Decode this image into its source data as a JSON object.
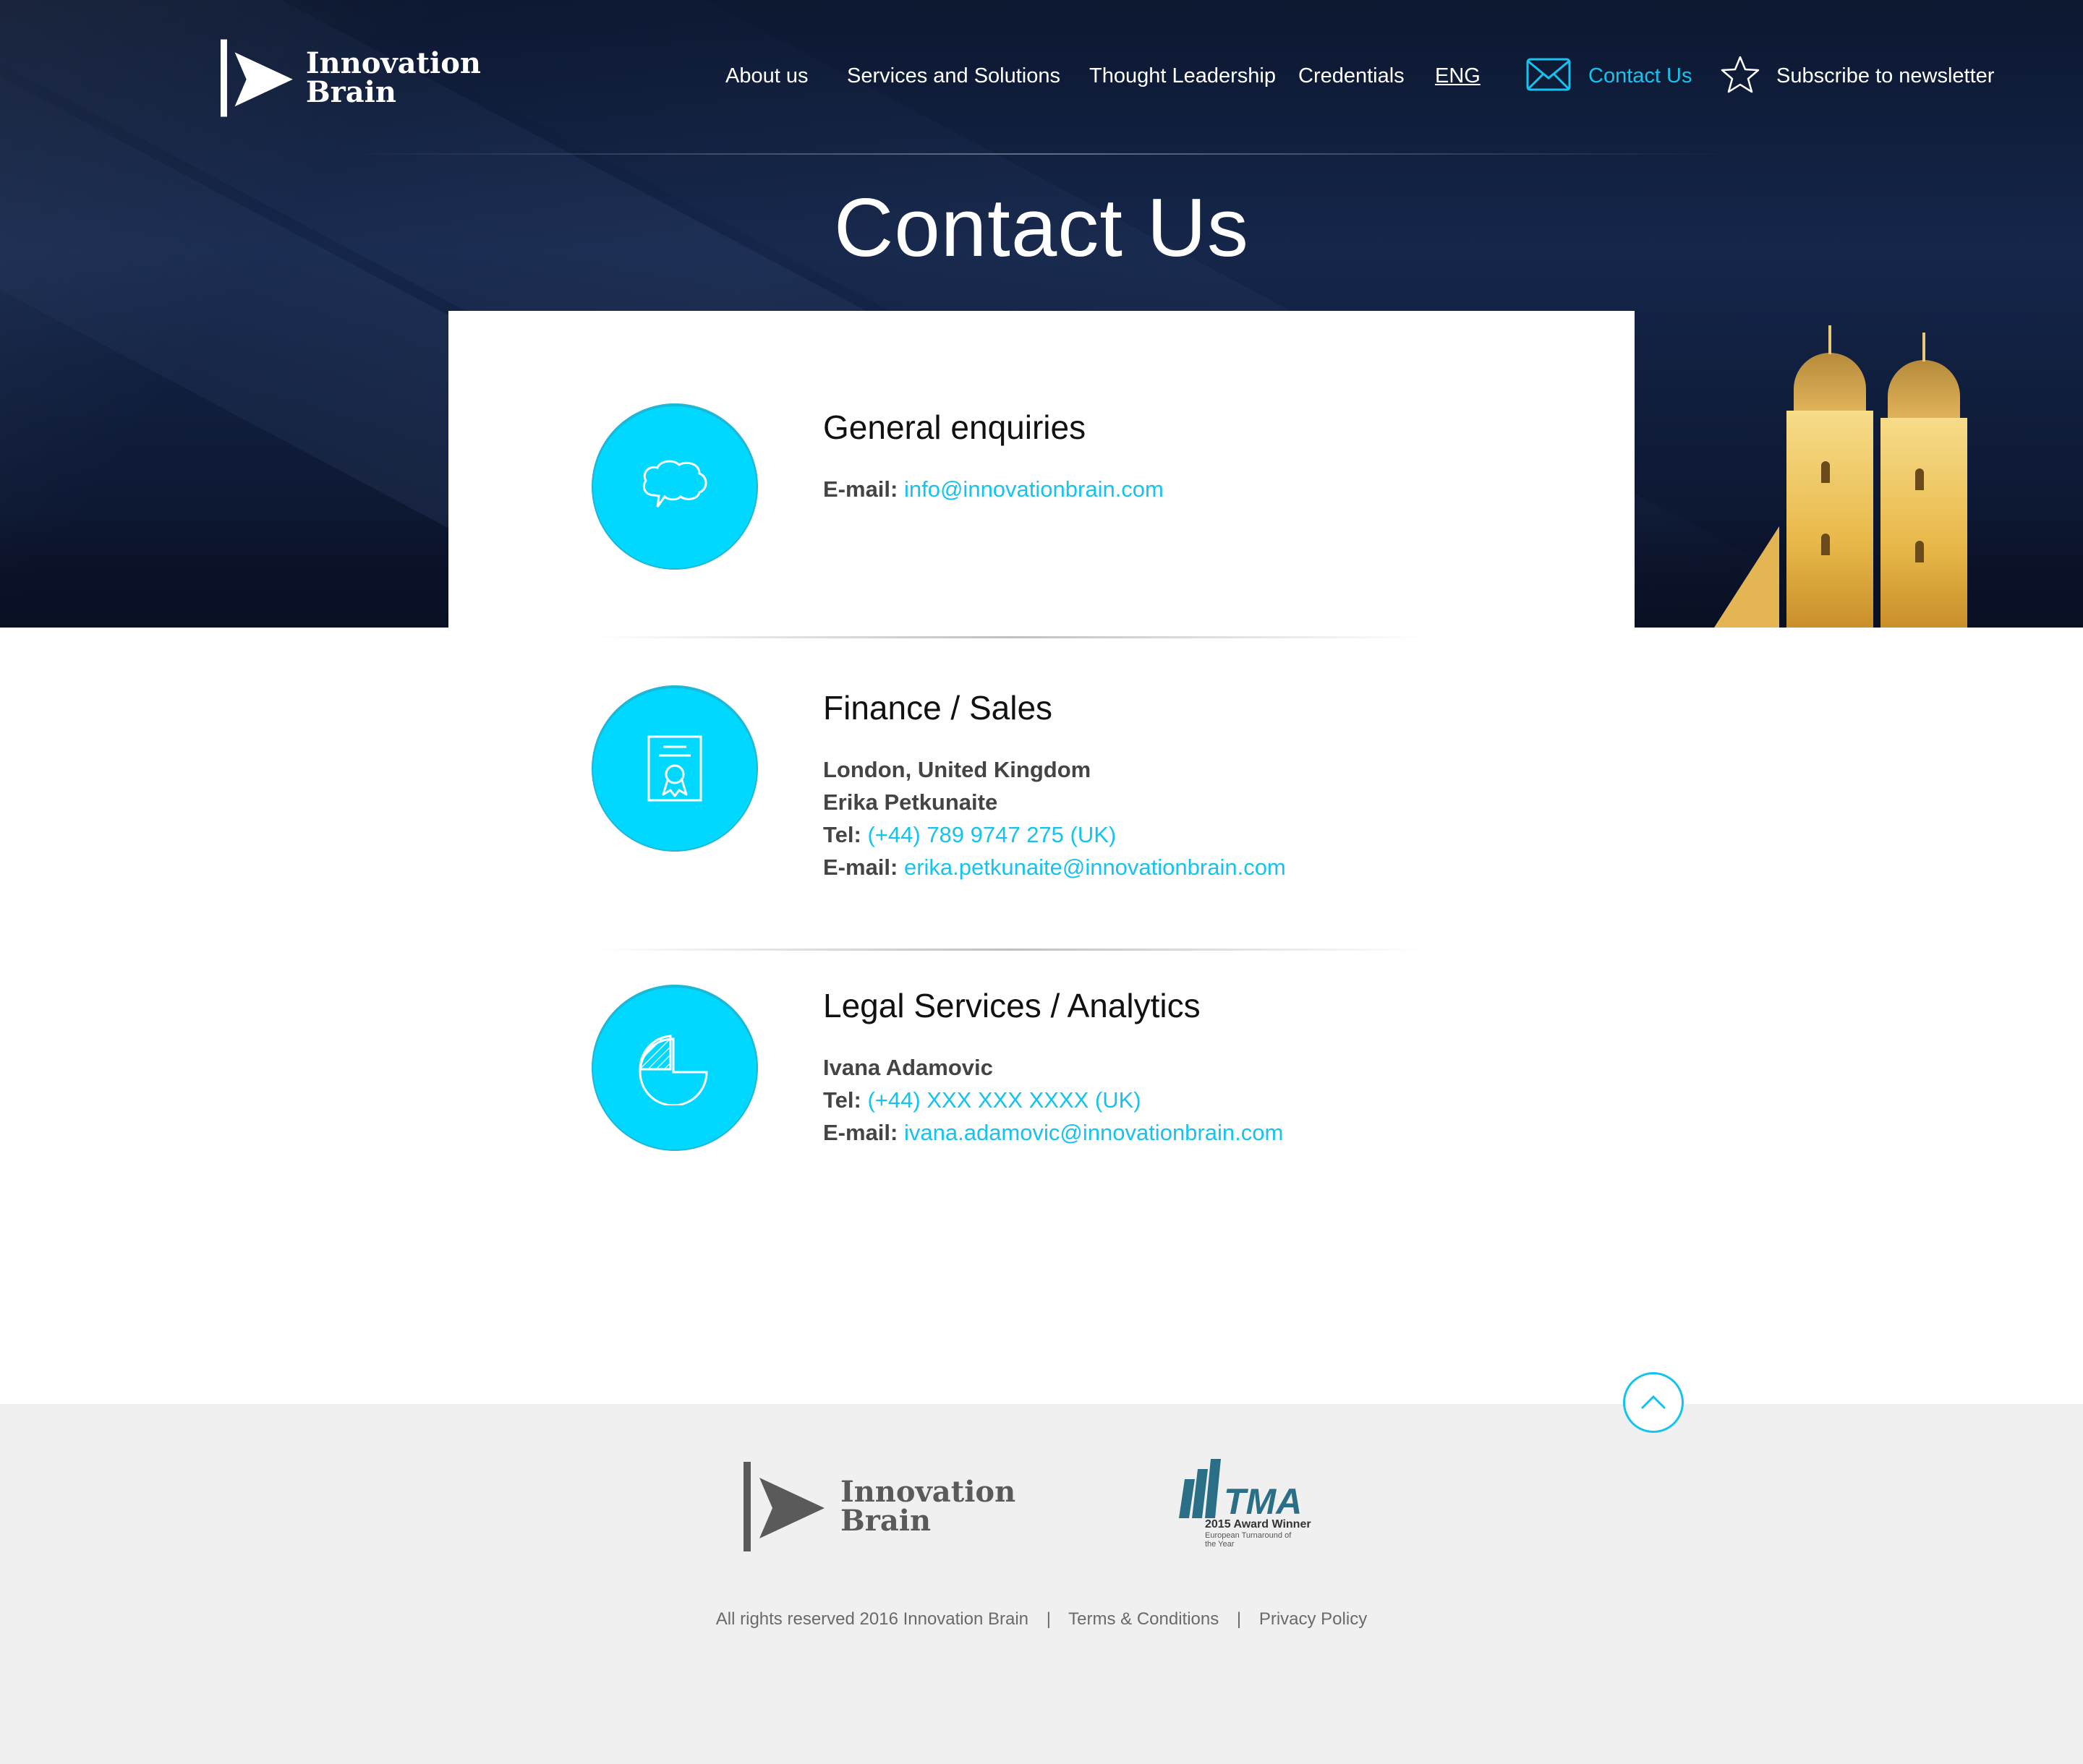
{
  "brand": {
    "line1": "Innovation",
    "line2": "Brain"
  },
  "nav": {
    "about": "About us",
    "services": "Services and Solutions",
    "thought": "Thought Leadership",
    "credentials": "Credentials",
    "lang": "ENG",
    "contact": "Contact Us",
    "subscribe": "Subscribe to newsletter"
  },
  "page": {
    "title": "Contact Us"
  },
  "sections": {
    "general": {
      "title": "General enquiries",
      "email_label": "E-mail:",
      "email": "info@innovationbrain.com",
      "icon": "speech-bubble-icon"
    },
    "finance": {
      "title": "Finance / Sales",
      "location": "London, United Kingdom",
      "person": "Erika Petkunaite",
      "tel_label": "Tel:",
      "tel": "(+44) 789 9747 275 (UK)",
      "email_label": "E-mail:",
      "email": "erika.petkunaite@innovationbrain.com",
      "icon": "certificate-icon"
    },
    "legal": {
      "title": "Legal Services / Analytics",
      "person": "Ivana Adamovic",
      "tel_label": "Tel:",
      "tel": "(+44) XXX XXX XXXX (UK)",
      "email_label": "E-mail:",
      "email": "ivana.adamovic@innovationbrain.com",
      "icon": "pie-chart-icon"
    }
  },
  "footer": {
    "tma": {
      "name": "TMA",
      "award": "2015 Award Winner",
      "sub": "European Turnaround of the Year"
    },
    "copyright": "All rights reserved 2016 Innovation Brain",
    "separator": "|",
    "terms": "Terms & Conditions",
    "privacy": "Privacy Policy"
  },
  "colors": {
    "accent": "#16c3ef",
    "circle": "#00d8ff",
    "hero": "#15264a",
    "footer_bg": "#f0f0f0"
  }
}
